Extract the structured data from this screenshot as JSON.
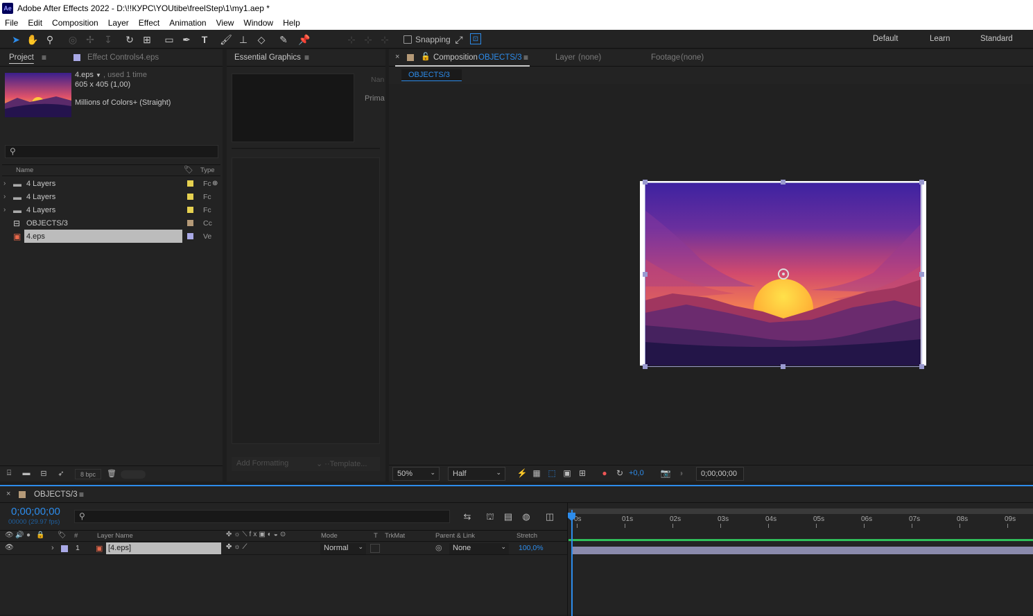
{
  "window": {
    "app_badge": "Ae",
    "title": "Adobe After Effects 2022 - D:\\!!КУРС\\YOUtibe\\freelStep\\1\\my1.aep *"
  },
  "menu": [
    "File",
    "Edit",
    "Composition",
    "Layer",
    "Effect",
    "Animation",
    "View",
    "Window",
    "Help"
  ],
  "toolbar": {
    "snapping_label": "Snapping",
    "workspaces": [
      "Default",
      "Learn",
      "Standard"
    ]
  },
  "project_panel": {
    "tab_project": "Project",
    "tab_effect_controls": "Effect Controls",
    "effect_controls_target": "4.eps",
    "preview": {
      "name": "4.eps",
      "usage": ", used 1 time",
      "dimensions": "605 x 405 (1,00)",
      "colors": "Millions of Colors+ (Straight)"
    },
    "search_placeholder": "",
    "columns": {
      "name": "Name",
      "type": "Type"
    },
    "items": [
      {
        "name": "4 Layers",
        "type": "Fc",
        "kind": "folder",
        "label_color": "#e6d150"
      },
      {
        "name": "4 Layers",
        "type": "Fc",
        "kind": "folder",
        "label_color": "#e6d150"
      },
      {
        "name": "4 Layers",
        "type": "Fc",
        "kind": "folder",
        "label_color": "#e6d150"
      },
      {
        "name": "OBJECTS/3",
        "type": "Cc",
        "kind": "comp",
        "label_color": "#b59a78"
      },
      {
        "name": "4.eps",
        "type": "Ve",
        "kind": "eps",
        "label_color": "#a9a9e6",
        "selected": true
      }
    ],
    "bpc": "8 bpc"
  },
  "essential_graphics": {
    "title": "Essential Graphics",
    "name_label": "Nan",
    "primary_label": "Prima",
    "add_formatting": "Add Formatting",
    "template": "Template..."
  },
  "composition_panel": {
    "tab_label": "Composition",
    "comp_name": "OBJECTS/3",
    "layer_tab": "Layer",
    "layer_value": "(none)",
    "footage_tab": "Footage",
    "footage_value": "(none)",
    "breadcrumb": "OBJECTS/3",
    "zoom": "50%",
    "resolution": "Half",
    "exposure": "+0,0",
    "timecode": "0;00;00;00"
  },
  "timeline": {
    "comp_tab": "OBJECTS/3",
    "timecode": "0;00;00;00",
    "fps": "00000 (29.97 fps)",
    "columns": {
      "num": "#",
      "layer_name": "Layer Name",
      "mode": "Mode",
      "t": "T",
      "trkmat": "TrkMat",
      "parent": "Parent & Link",
      "stretch": "Stretch"
    },
    "ruler": [
      "0s",
      "01s",
      "02s",
      "03s",
      "04s",
      "05s",
      "06s",
      "07s",
      "08s",
      "09s"
    ],
    "layers": [
      {
        "index": "1",
        "name": "[4.eps]",
        "mode": "Normal",
        "parent": "None",
        "stretch": "100,0%"
      }
    ]
  },
  "colors": {
    "accent": "#2d8ceb",
    "work_area": "#2fbf5a",
    "layer_bar": "#8a8aac"
  }
}
